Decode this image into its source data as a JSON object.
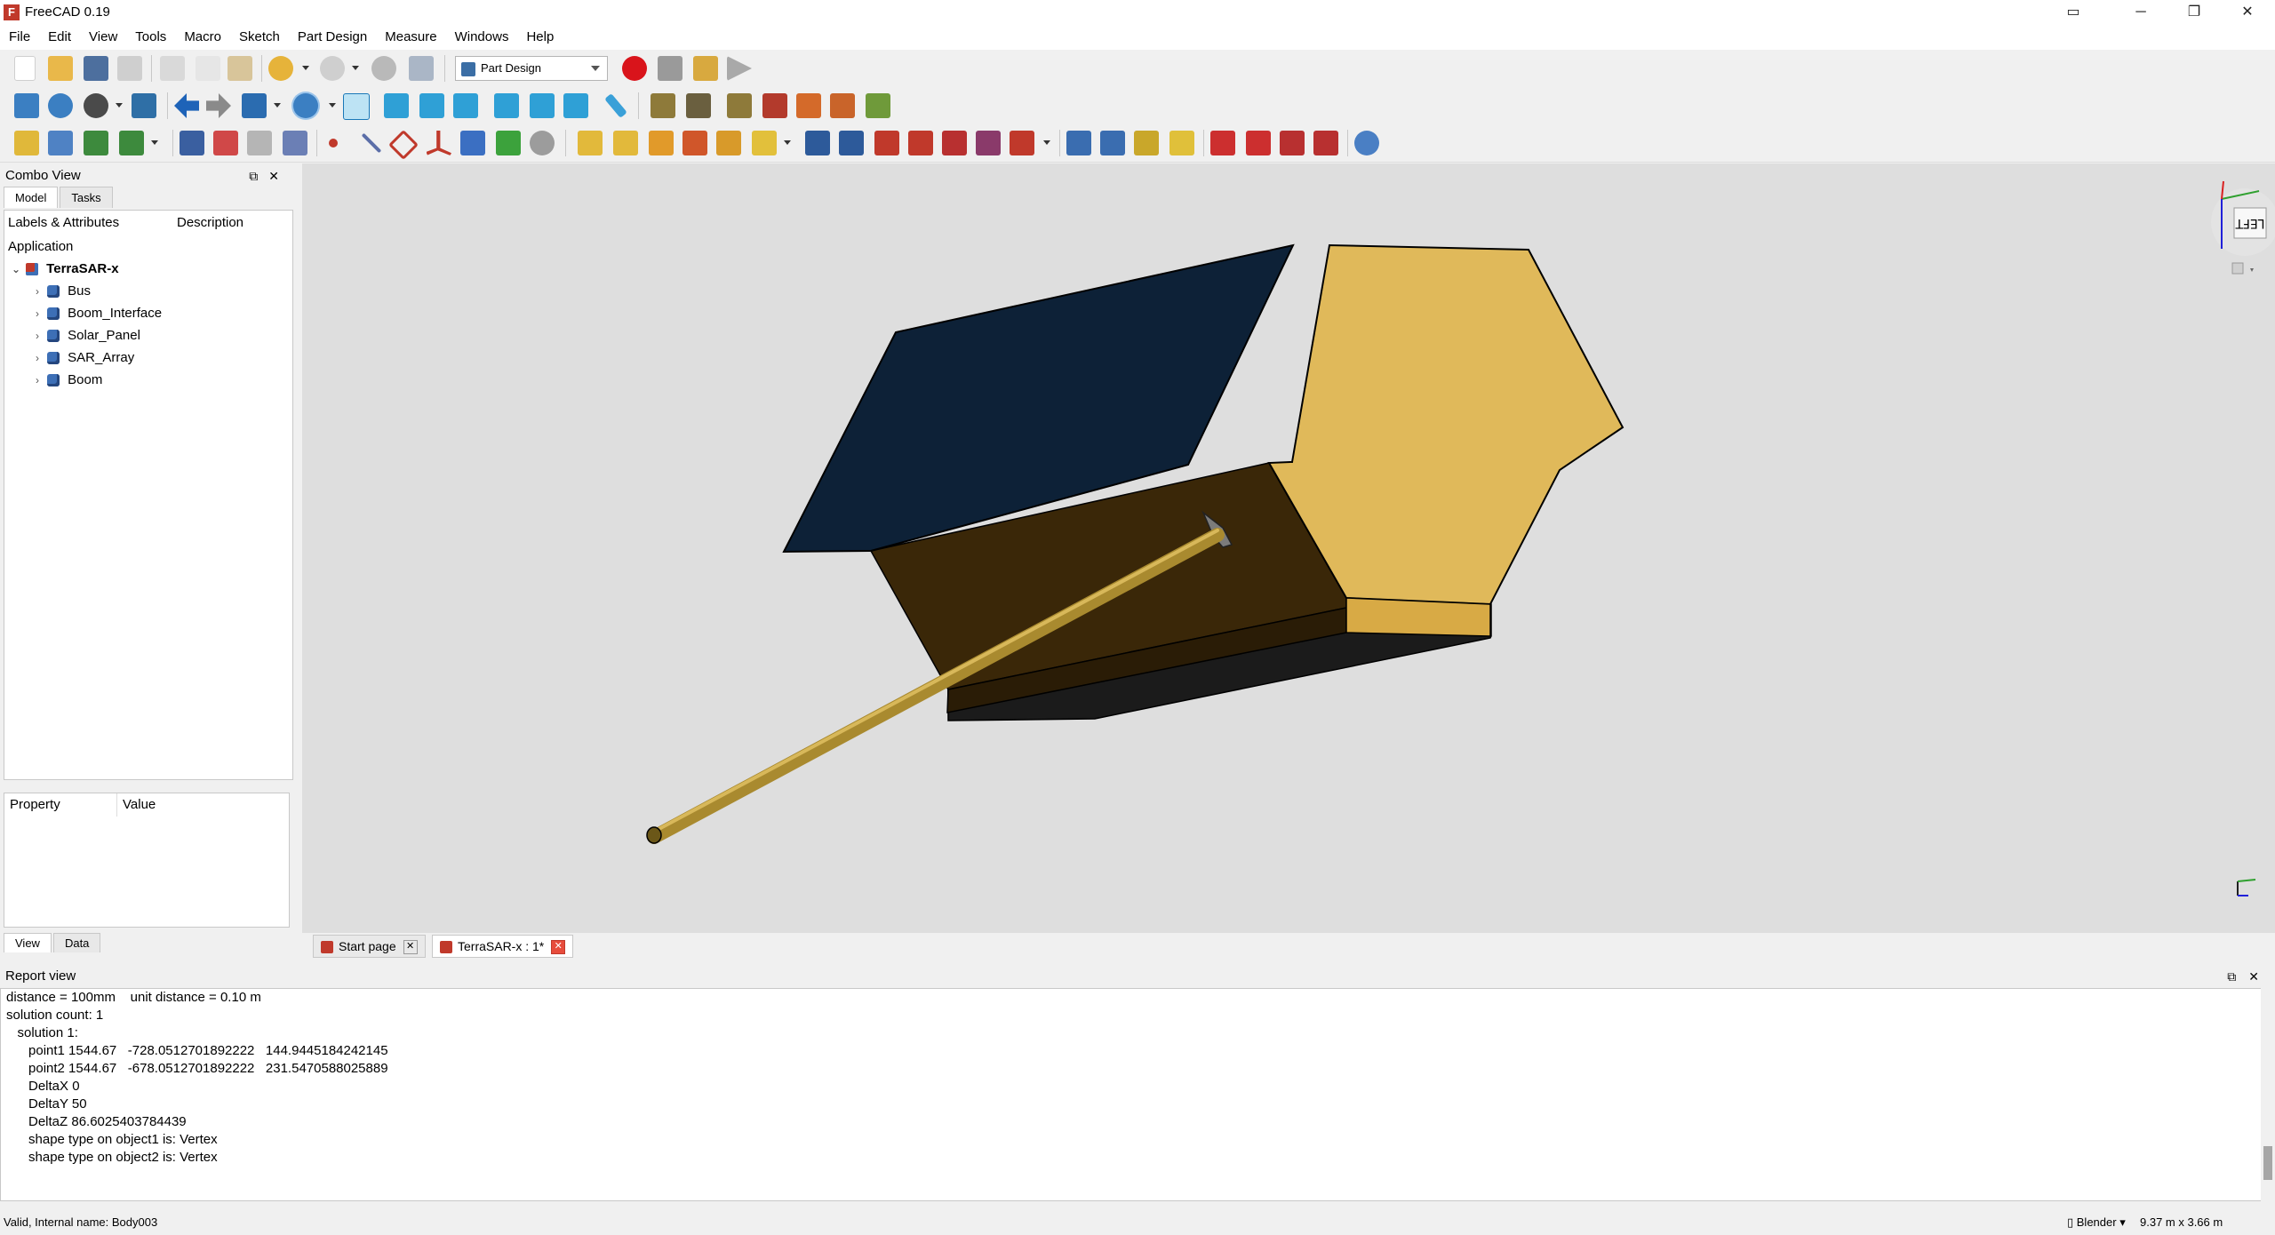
{
  "window": {
    "title": "FreeCAD 0.19",
    "min": "─",
    "max": "❐",
    "close": "✕"
  },
  "menu": [
    "File",
    "Edit",
    "View",
    "Tools",
    "Macro",
    "Sketch",
    "Part Design",
    "Measure",
    "Windows",
    "Help"
  ],
  "workbench": {
    "selected": "Part Design"
  },
  "combo_view": {
    "title": "Combo View",
    "tabs": [
      "Model",
      "Tasks"
    ],
    "tree": {
      "col_labels": "Labels & Attributes",
      "col_description": "Description",
      "section": "Application",
      "root": "TerraSAR-x",
      "items": [
        "Bus",
        "Boom_Interface",
        "Solar_Panel",
        "SAR_Array",
        "Boom"
      ]
    },
    "properties": {
      "col_property": "Property",
      "col_value": "Value",
      "tabs": [
        "View",
        "Data"
      ]
    }
  },
  "doc_tabs": [
    {
      "label": "Start page",
      "active": false
    },
    {
      "label": "TerraSAR-x : 1*",
      "active": true
    }
  ],
  "navcube": {
    "face": "LEFT"
  },
  "colors": {
    "solar_panel": "#0d2137",
    "bus_top": "#e0b95a",
    "bus_side": "#3a2708",
    "bus_bottom": "#1b1b1b",
    "boom": "#a98a2f",
    "background": "#dedede"
  },
  "report": {
    "title": "Report view",
    "lines": [
      "distance = 100mm    unit distance = 0.10 m",
      "solution count: 1",
      "   solution 1:",
      "      point1 1544.67   -728.0512701892222   144.9445184242145",
      "      point2 1544.67   -678.0512701892222   231.5470588025889",
      "      DeltaX 0",
      "      DeltaY 50",
      "      DeltaZ 86.6025403784439",
      "      shape type on object1 is: Vertex",
      "      shape type on object2 is: Vertex"
    ]
  },
  "status": {
    "message": "Valid, Internal name: Body003",
    "navigation": "Blender",
    "dimensions": "9.37 m x 3.66 m"
  }
}
